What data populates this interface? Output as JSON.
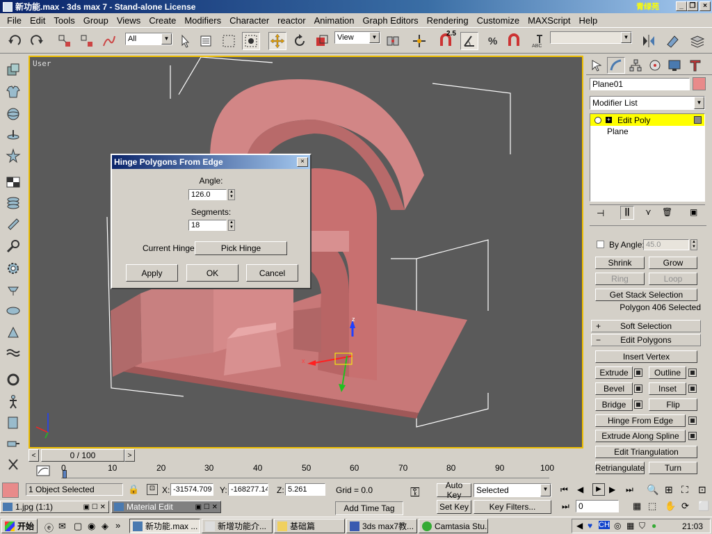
{
  "window": {
    "title": "新功能.max - 3ds max 7 - Stand-alone License",
    "logo_text": "青绿苑",
    "min": "_",
    "restore": "❐",
    "close": "×"
  },
  "menu": [
    "File",
    "Edit",
    "Tools",
    "Group",
    "Views",
    "Create",
    "Modifiers",
    "Character",
    "reactor",
    "Animation",
    "Graph Editors",
    "Rendering",
    "Customize",
    "MAXScript",
    "Help"
  ],
  "toolbar": {
    "selection_filter": "All",
    "ref_coord": "View",
    "angle_snap_label": "2.5"
  },
  "viewport": {
    "label": "User"
  },
  "dialog": {
    "title": "Hinge Polygons From Edge",
    "angle_label": "Angle:",
    "angle_value": "126.0",
    "segments_label": "Segments:",
    "segments_value": "18",
    "current_hinge_label": "Current Hinge:",
    "pick_hinge": "Pick Hinge",
    "apply": "Apply",
    "ok": "OK",
    "cancel": "Cancel",
    "close": "×"
  },
  "command_panel": {
    "object_name": "Plane01",
    "object_color": "#e88a8a",
    "modifier_list": "Modifier List",
    "stack": [
      "Edit Poly",
      "Plane"
    ],
    "by_angle_label": "By Angle:",
    "by_angle_value": "45.0",
    "shrink": "Shrink",
    "grow": "Grow",
    "ring": "Ring",
    "loop": "Loop",
    "get_stack_selection": "Get Stack Selection",
    "selection_info": "Polygon 406 Selected",
    "soft_selection": "Soft Selection",
    "soft_sign": "+",
    "edit_polygons": "Edit Polygons",
    "edit_sign": "−",
    "insert_vertex": "Insert Vertex",
    "extrude": "Extrude",
    "outline": "Outline",
    "bevel": "Bevel",
    "inset": "Inset",
    "bridge": "Bridge",
    "flip": "Flip",
    "hinge_from_edge": "Hinge From Edge",
    "extrude_along_spline": "Extrude Along Spline",
    "edit_triangulation": "Edit Triangulation",
    "retriangulate": "Retriangulate",
    "turn": "Turn"
  },
  "timeslider": {
    "label": "0 / 100",
    "left": "<",
    "right": ">"
  },
  "timeline_ticks": [
    "0",
    "10",
    "20",
    "30",
    "40",
    "50",
    "60",
    "70",
    "80",
    "90",
    "100"
  ],
  "status": {
    "objects_selected": "1 Object Selected",
    "x_label": "X:",
    "x": "-31574.709",
    "y_label": "Y:",
    "y": "-168277.14",
    "z_label": "Z:",
    "z": "5.261",
    "grid": "Grid = 0.0",
    "add_time_tag": "Add Time Tag",
    "auto_key": "Auto Key",
    "set_key": "Set Key",
    "selected": "Selected",
    "key_filters": "Key Filters...",
    "frame": "0"
  },
  "mdi": [
    {
      "label": "1.jpg (1:1)"
    },
    {
      "label": "Material Edit"
    }
  ],
  "taskbar": {
    "start": "开始",
    "tasks": [
      "新功能.max ...",
      "新增功能介...",
      "基础篇",
      "3ds max7教...",
      "Camtasia Stu..."
    ],
    "time": "21:03",
    "more": "»"
  },
  "colors": {
    "object": "#d98a8a",
    "viewport_bg": "#5a5a5a",
    "active_border": "#f0c000",
    "title_start": "#0a246a",
    "stack_highlight": "#ffff00"
  }
}
